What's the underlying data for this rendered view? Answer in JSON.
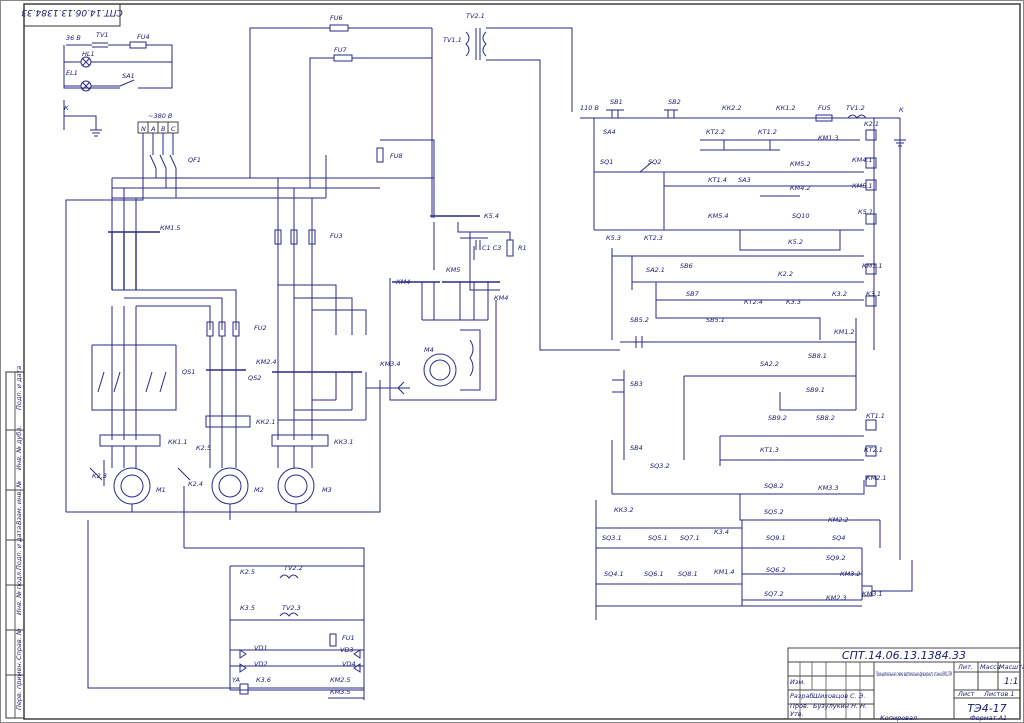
{
  "stamp_top": "СПТ.14.06.13.1384.33",
  "power": {
    "v36": "36 В",
    "v380": "~380 В",
    "v110": "110 В",
    "phases": [
      "N",
      "A",
      "B",
      "C"
    ],
    "ground": "К"
  },
  "motors": [
    "М1",
    "М2",
    "М3",
    "М4"
  ],
  "left_components": {
    "tv1": "TV1",
    "fu4": "FU4",
    "hl1": "HL1",
    "el1": "EL1",
    "sa1": "SA1",
    "qf1": "QF1",
    "km15": "КМ1.5",
    "fu3": "FU3",
    "fu2": "FU2",
    "qs1": "QS1",
    "qs2": "QS2",
    "km24": "КМ2.4",
    "km34": "КМ3.4",
    "kk11": "КК1.1",
    "kk21": "КК2.1",
    "kk31": "КК3.1",
    "k23": "К2.3",
    "k24": "К2.4",
    "k25": "К2.5"
  },
  "top_components": {
    "fu6": "FU6",
    "fu7": "FU7",
    "tv21": "TV2.1",
    "tv11": "TV1.1",
    "fu8": "FU8",
    "k54": "К5.4",
    "r1": "R1",
    "c13": "С1 С3",
    "km5": "КМ5",
    "km4a": "КМ4",
    "km4b": "КМ4"
  },
  "bottom_components": {
    "k25": "К2.5",
    "tv22": "TV2.2",
    "k35": "К3.5",
    "tv23": "TV2.3",
    "vd1": "VD1",
    "vd2": "VD2",
    "vd3": "VD3",
    "vd4": "VD4",
    "fu1": "FU1",
    "ya": "YA",
    "k36": "К3.6",
    "km25": "КМ2.5",
    "km35": "КМ3.5"
  },
  "control_rows": [
    [
      "SB1",
      "SB2",
      "КК2.2",
      "КК1.2",
      "FU5",
      "TV1.2",
      "К"
    ],
    [
      "SA4",
      "КТ2.2",
      "КТ1.2",
      "КМ1.3",
      "К2.1"
    ],
    [
      "SQ1",
      "SQ2",
      "КМ5.2",
      "КМ4.1"
    ],
    [
      "КТ1.4",
      "SA3",
      "КМ4.2",
      "КМ5.1"
    ],
    [
      "КМ5.4",
      "SQ10",
      "К5.1"
    ],
    [
      "К5.2"
    ],
    [
      "К5.3",
      "КТ2.3",
      "КМ1.1"
    ],
    [
      "SA2.1",
      "SB6",
      "К2.2"
    ],
    [
      "SB7",
      "КТ2.4",
      "К3.3",
      "К3.2",
      "К3.1"
    ],
    [
      "SB5.2",
      "SB5.1",
      "КМ1.2"
    ],
    [
      "SA2.2",
      "SB8.1"
    ],
    [
      "SB3",
      "SB9.1"
    ],
    [
      "SB9.2",
      "SB8.2",
      "КТ1.1"
    ],
    [
      "КТ1.3",
      "КТ2.1"
    ],
    [
      "SB4",
      "SQ3.2",
      "КМ2.1"
    ],
    [
      "SQ8.2",
      "КМ3.3"
    ],
    [
      "КК3.2",
      "SQ5.2",
      "КМ2.2"
    ],
    [
      "SQ3.1",
      "SQ5.1",
      "SQ7.1",
      "К3.4",
      "SQ9.1",
      "SQ4"
    ],
    [
      "SQ9.2"
    ],
    [
      "SQ4.1",
      "SQ6.1",
      "SQ8.1",
      "КМ1.4",
      "SQ6.2",
      "КМ3.2"
    ],
    [
      "SQ7.2",
      "КМ2.3",
      "КМ3.1"
    ]
  ],
  "side_strip": [
    "Подп. и дата",
    "Инв. № дубл.",
    "Взам. инв. №",
    "Подп. и дата",
    "Инв. № подл.",
    "Справ. №",
    "Перв. примен."
  ],
  "title_block": {
    "doc_code": "СПТ.14.06.13.1384.33",
    "title": "Принципиальная схема вертикально-фрезерного станка ВМ127М",
    "sheet_label": "Лит.",
    "mass_label": "Масса",
    "scale_label": "Масштаб",
    "scale": "1:1",
    "sheet": "Лист",
    "sheets": "Листов 1",
    "group": "ТЭ4-17",
    "rows": [
      "Изм.",
      "Лист",
      "№ докум.",
      "Подп.",
      "Дата"
    ],
    "roles": [
      "Разраб.",
      "Пров.",
      "Т.контр.",
      "Н.контр.",
      "Утв."
    ],
    "names": [
      "Шиховцов С. Э.",
      "Бузулукин Н. Н."
    ],
    "copied": "Копировал",
    "format": "Формат А1"
  }
}
